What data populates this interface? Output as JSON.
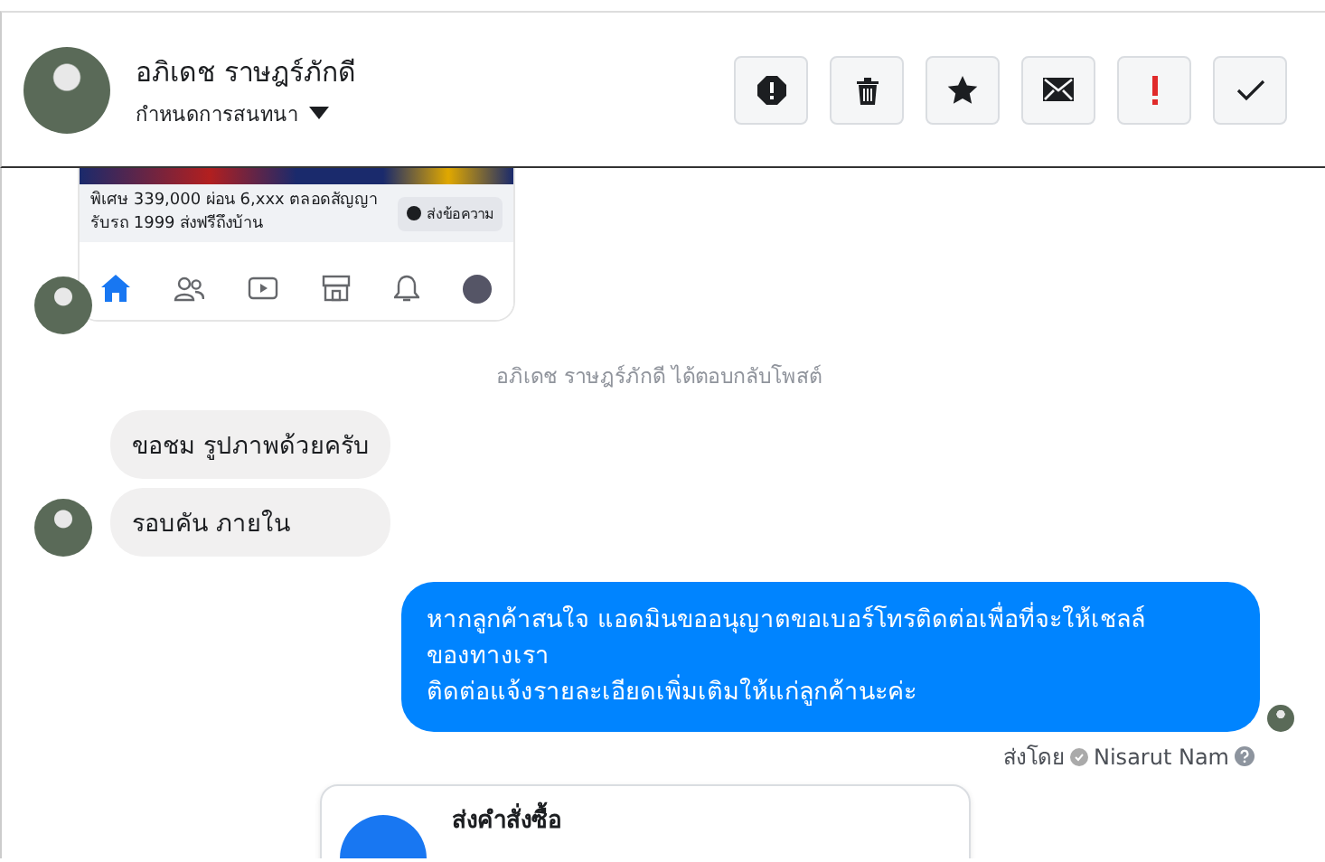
{
  "header": {
    "name": "อภิเดช ราษฎร์ภักดี",
    "assign_label": "กำหนดการสนทนา",
    "actions": [
      {
        "kind": "spam"
      },
      {
        "kind": "delete"
      },
      {
        "kind": "star"
      },
      {
        "kind": "unread"
      },
      {
        "kind": "important"
      },
      {
        "kind": "done"
      }
    ]
  },
  "shared_post": {
    "offer_lines": [
      "พิเศษ 339,000 ผ่อน 6,xxx ตลอดสัญญา",
      "รับรถ 1999 ส่งฟรีถึงบ้าน"
    ],
    "button": "ส่งข้อความ"
  },
  "system_note": "อภิเดช ราษฎร์ภักดี ได้ตอบกลับโพสต์",
  "incoming": [
    "ขอชม รูปภาพด้วยครับ",
    "รอบคัน ภายใน"
  ],
  "outgoing": {
    "lines": [
      "หากลูกค้าสนใจ แอดมินขออนุญาตขอเบอร์โทรติดต่อเพื่อที่จะให้เชลล์",
      "ของทางเรา",
      "ติดต่อแจ้งรายละเอียดเพิ่มเติมให้แก่ลูกค้านะค่ะ"
    ]
  },
  "sent_by": {
    "label": "ส่งโดย",
    "name": "Nisarut Nam"
  },
  "order_card": {
    "title": "ส่งคำสั่งซื้อ"
  }
}
